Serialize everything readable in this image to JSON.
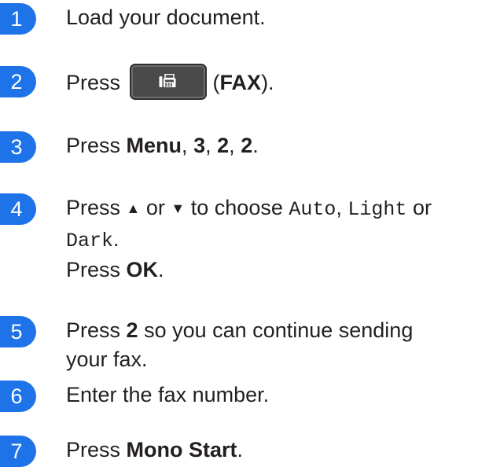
{
  "steps": [
    {
      "number": "1",
      "text": "Load your document."
    },
    {
      "number": "2",
      "before": "Press",
      "button_label": "FAX",
      "open": "(",
      "close": ")."
    },
    {
      "number": "3",
      "press": "Press",
      "menu": "Menu",
      "sep1": ",",
      "k1": "3",
      "sep2": ",",
      "k2": "2",
      "sep3": ",",
      "k3": "2",
      "end": "."
    },
    {
      "number": "4",
      "press": "Press",
      "up": "▲",
      "or1": "or",
      "down": "▼",
      "to_choose": "to choose",
      "opt1": "Auto",
      "comma": ",",
      "opt2": "Light",
      "or2": "or",
      "opt3": "Dark",
      "dot": ".",
      "press2": "Press",
      "ok": "OK",
      "dot2": "."
    },
    {
      "number": "5",
      "press": "Press",
      "key": "2",
      "rest_line1": "so you can continue sending",
      "rest_line2": "your fax."
    },
    {
      "number": "6",
      "text": "Enter the fax number."
    },
    {
      "number": "7",
      "press": "Press",
      "action": "Mono Start",
      "dot": "."
    }
  ]
}
